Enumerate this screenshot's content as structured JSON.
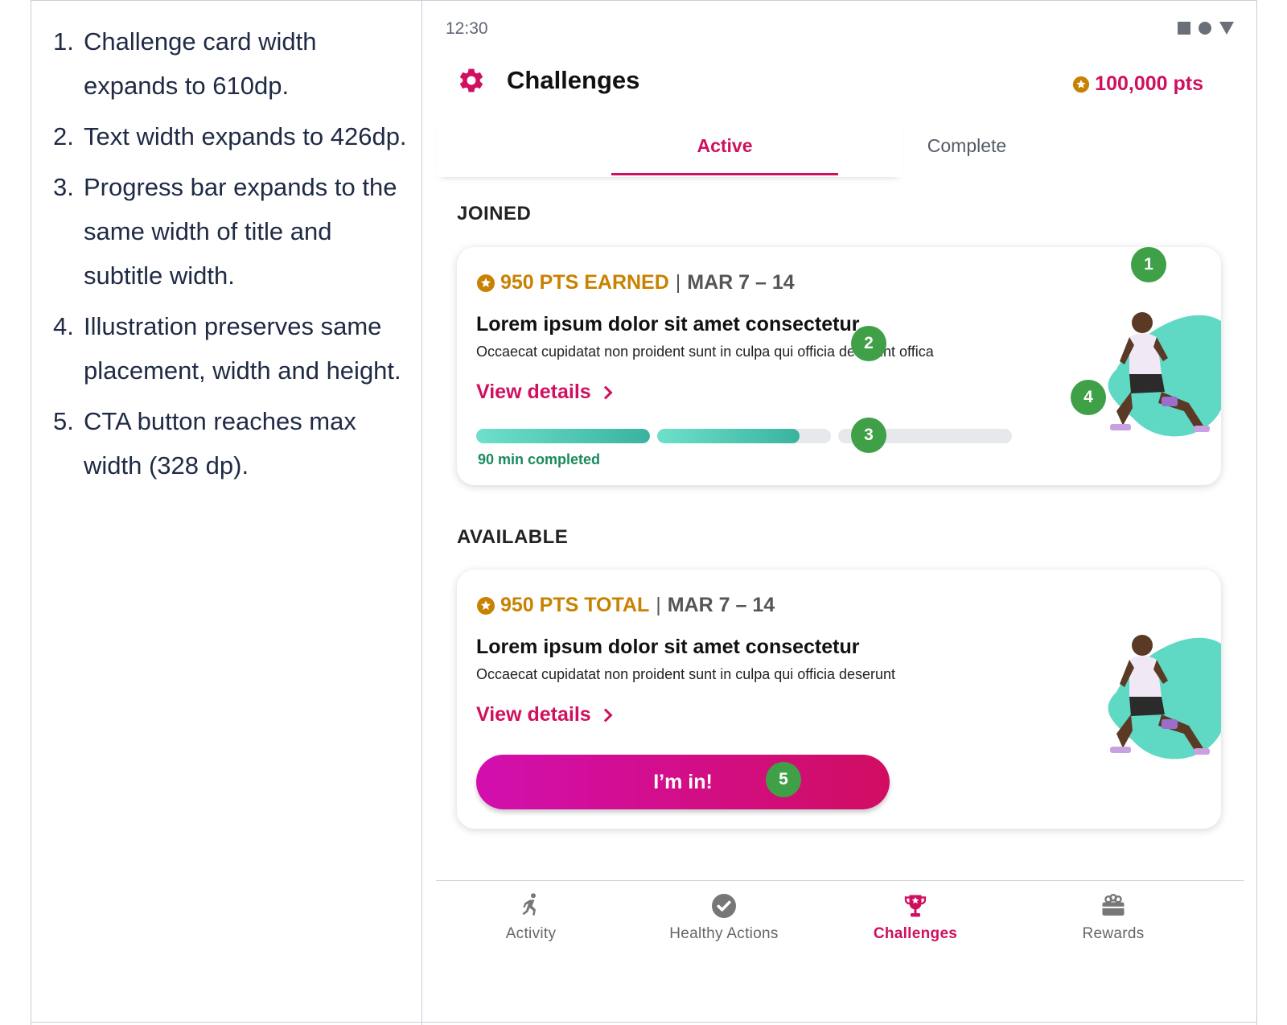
{
  "notes": [
    {
      "num": "1.",
      "text": "Challenge card width expands to 610dp."
    },
    {
      "num": "2.",
      "text": "Text width expands to 426dp."
    },
    {
      "num": "3.",
      "text": "Progress bar expands to the same width of title and subtitle width."
    },
    {
      "num": "4.",
      "text": "Illustration preserves same placement, width and height."
    },
    {
      "num": "5.",
      "text": "CTA button reaches max width (328 dp)."
    }
  ],
  "status_bar": {
    "time": "12:30",
    "icons": [
      "square-icon",
      "circle-icon",
      "triangle-icon"
    ]
  },
  "header": {
    "title": "Challenges",
    "points": "100,000 pts",
    "icon": "gear-icon"
  },
  "tabs": [
    {
      "label": "Active",
      "selected": true
    },
    {
      "label": "Complete",
      "selected": false
    }
  ],
  "joined": {
    "section_label": "JOINED",
    "card": {
      "points": "950 PTS EARNED",
      "separator": "|",
      "date": "MAR 7 – 14",
      "title": "Lorem ipsum dolor sit amet consectetur",
      "subtitle": "Occaecat cupidatat non proident sunt in culpa qui officia deserunt offica",
      "link": "View details",
      "progress": {
        "segment_fills": [
          1.0,
          0.82,
          0.0
        ],
        "label": "90 min completed"
      }
    }
  },
  "available": {
    "section_label": "AVAILABLE",
    "card": {
      "points": "950 PTS TOTAL",
      "separator": "|",
      "date": "MAR 7 – 14",
      "title": "Lorem ipsum dolor sit amet consectetur",
      "subtitle": "Occaecat cupidatat non proident sunt in culpa qui officia deserunt",
      "link": "View details",
      "cta": "I’m in!"
    }
  },
  "markers": [
    "1",
    "2",
    "3",
    "4",
    "5"
  ],
  "bottom_nav": [
    {
      "label": "Activity",
      "icon": "running-person-icon",
      "active": false
    },
    {
      "label": "Healthy Actions",
      "icon": "check-circle-icon",
      "active": false
    },
    {
      "label": "Challenges",
      "icon": "trophy-icon",
      "active": true
    },
    {
      "label": "Rewards",
      "icon": "gift-box-icon",
      "active": false
    }
  ],
  "colors": {
    "brand": "#d0105f",
    "gold": "#c98100",
    "teal": "#4fcfb8",
    "marker": "#3fa047",
    "progress_text": "#1a8a5e"
  }
}
